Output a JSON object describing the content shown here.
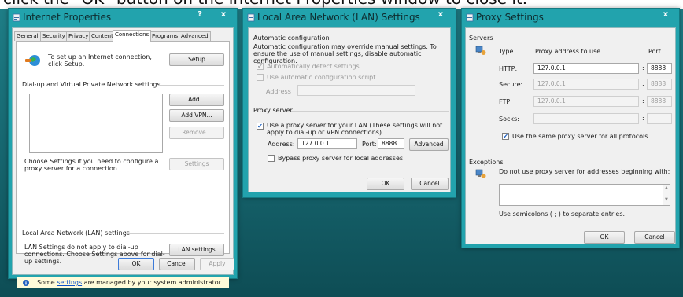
{
  "top_strip": {
    "text": "click the \"OK\" button on the Internet Properties window to close it."
  },
  "internet_properties": {
    "title": "Internet Properties",
    "help_label": "?",
    "close_label": "x",
    "tabs": [
      {
        "label": "General"
      },
      {
        "label": "Security"
      },
      {
        "label": "Privacy"
      },
      {
        "label": "Content"
      },
      {
        "label": "Connections"
      },
      {
        "label": "Programs"
      },
      {
        "label": "Advanced"
      }
    ],
    "setup_text": "To set up an Internet connection, click Setup.",
    "setup_button": "Setup",
    "dialup_header": "Dial-up and Virtual Private Network settings",
    "add_button": "Add...",
    "add_vpn_button": "Add VPN...",
    "remove_button": "Remove...",
    "settings_button": "Settings",
    "choose_text": "Choose Settings if you need to configure a proxy server for a connection.",
    "lan_header": "Local Area Network (LAN) settings",
    "lan_text": "LAN Settings do not apply to dial-up connections. Choose Settings above for dial-up settings.",
    "lan_settings_button": "LAN settings",
    "admin_note_prefix": "Some ",
    "admin_note_link": "settings",
    "admin_note_suffix": " are managed by your system administrator.",
    "ok_button": "OK",
    "cancel_button": "Cancel",
    "apply_button": "Apply"
  },
  "lan_settings": {
    "title": "Local Area Network (LAN) Settings",
    "close_label": "x",
    "auto_config_header": "Automatic configuration",
    "auto_config_text": "Automatic configuration may override manual settings.  To ensure the use of manual settings, disable automatic configuration.",
    "auto_detect_label": "Automatically detect settings",
    "auto_detect_checked": true,
    "auto_script_label": "Use automatic configuration script",
    "auto_script_checked": false,
    "address_label": "Address",
    "proxy_server_header": "Proxy server",
    "use_proxy_label": "Use a proxy server for your LAN (These settings will not apply to dial-up or VPN connections).",
    "use_proxy_checked": true,
    "proxy_address_label": "Address:",
    "proxy_address_value": "127.0.0.1",
    "port_label": "Port:",
    "port_value": "8888",
    "advanced_button": "Advanced",
    "bypass_label": "Bypass proxy server for local addresses",
    "bypass_checked": false,
    "ok_button": "OK",
    "cancel_button": "Cancel"
  },
  "proxy_settings": {
    "title": "Proxy Settings",
    "close_label": "x",
    "servers_header": "Servers",
    "col_type": "Type",
    "col_address": "Proxy address to use",
    "col_port": "Port",
    "rows": [
      {
        "label": "HTTP:",
        "address": "127.0.0.1",
        "port": "8888",
        "enabled": true
      },
      {
        "label": "Secure:",
        "address": "127.0.0.1",
        "port": "8888",
        "enabled": false
      },
      {
        "label": "FTP:",
        "address": "127.0.0.1",
        "port": "8888",
        "enabled": false
      },
      {
        "label": "Socks:",
        "address": "",
        "port": "",
        "enabled": false
      }
    ],
    "colon": ":",
    "same_proxy_label": "Use the same proxy server for all protocols",
    "same_proxy_checked": true,
    "exceptions_header": "Exceptions",
    "exceptions_text": "Do not use proxy server for addresses beginning with:",
    "semicolons_text": "Use semicolons ( ; ) to separate entries.",
    "ok_button": "OK",
    "cancel_button": "Cancel"
  },
  "colors": {
    "desktop": "#1f7f88",
    "window_frame": "#22a3ad",
    "check_mark": "#1d5fbf",
    "link": "#0b52c8"
  }
}
